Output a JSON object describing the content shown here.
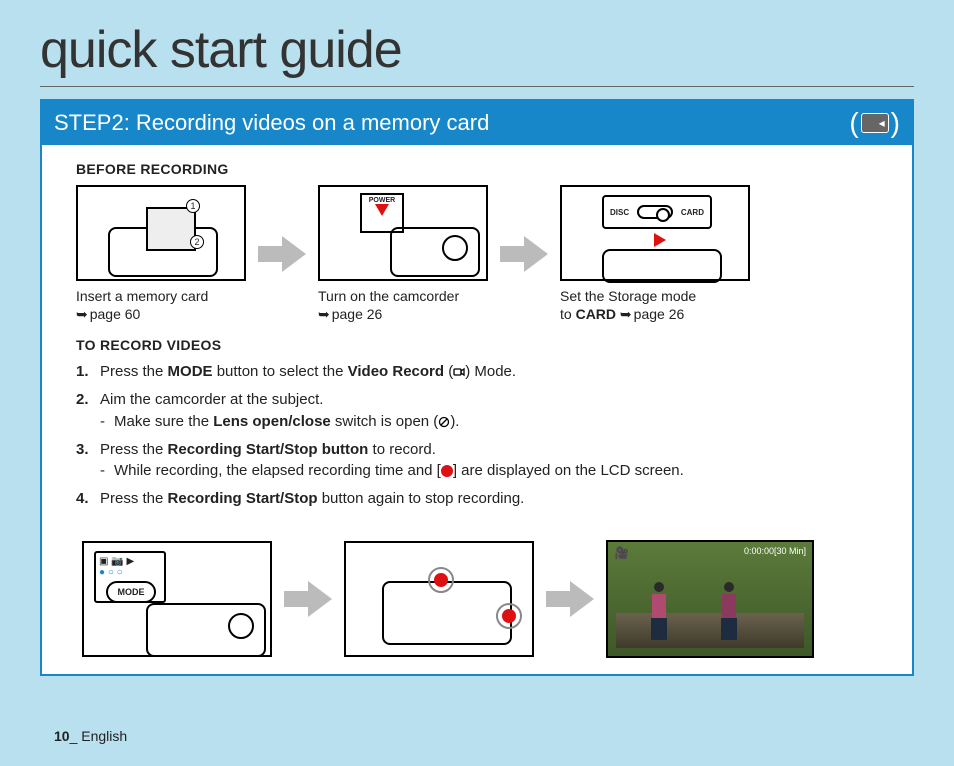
{
  "title": "quick start guide",
  "step_header": "STEP2: Recording videos on a memory card",
  "before": {
    "heading": "BEFORE RECORDING",
    "col1": {
      "caption": "Insert a memory card",
      "pageref": "page 60",
      "callout1": "1",
      "callout2": "2"
    },
    "col2": {
      "power_label": "POWER",
      "caption": "Turn on the camcorder",
      "pageref": "page 26"
    },
    "col3": {
      "disc": "DISC",
      "card": "CARD",
      "caption_a": "Set the Storage mode",
      "caption_b_pre": "to ",
      "caption_b_bold": "CARD",
      "pageref": "page 26"
    }
  },
  "record": {
    "heading": "TO RECORD VIDEOS",
    "step1_a": "Press the ",
    "step1_b": "MODE",
    "step1_c": " button to select the ",
    "step1_d": "Video Record",
    "step1_e": " (",
    "step1_f": ") Mode.",
    "step2": "Aim the camcorder at the subject.",
    "step2_sub_a": "Make sure the ",
    "step2_sub_b": "Lens open/close",
    "step2_sub_c": " switch is open (",
    "step2_sub_d": ").",
    "step3_a": "Press the ",
    "step3_b": "Recording Start/Stop button",
    "step3_c": " to record.",
    "step3_sub_a": "While recording, the elapsed recording time and [",
    "step3_sub_b": "] are displayed on the LCD screen.",
    "step4_a": "Press the ",
    "step4_b": "Recording Start/Stop",
    "step4_c": " button again to stop recording."
  },
  "bottom": {
    "mode_label": "MODE",
    "lcd_time": "0:00:00[30 Min]"
  },
  "footer": {
    "page": "10",
    "sep": "_ ",
    "lang": "English"
  }
}
